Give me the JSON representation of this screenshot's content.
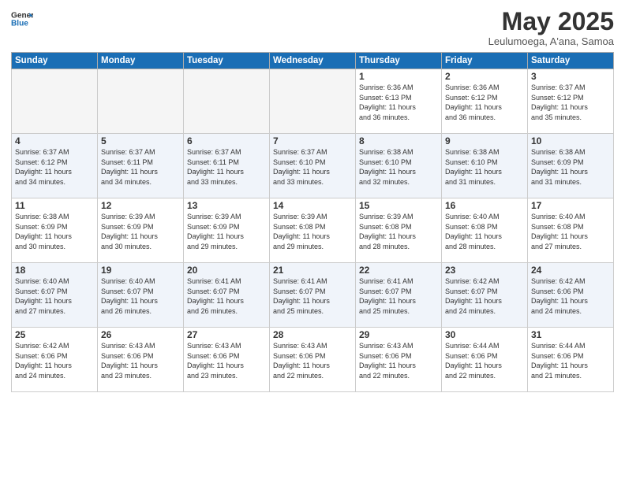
{
  "logo": {
    "line1": "General",
    "line2": "Blue"
  },
  "title": "May 2025",
  "subtitle": "Leulumoega, A'ana, Samoa",
  "days_of_week": [
    "Sunday",
    "Monday",
    "Tuesday",
    "Wednesday",
    "Thursday",
    "Friday",
    "Saturday"
  ],
  "weeks": [
    [
      {
        "day": "",
        "info": ""
      },
      {
        "day": "",
        "info": ""
      },
      {
        "day": "",
        "info": ""
      },
      {
        "day": "",
        "info": ""
      },
      {
        "day": "1",
        "info": "Sunrise: 6:36 AM\nSunset: 6:13 PM\nDaylight: 11 hours\nand 36 minutes."
      },
      {
        "day": "2",
        "info": "Sunrise: 6:36 AM\nSunset: 6:12 PM\nDaylight: 11 hours\nand 36 minutes."
      },
      {
        "day": "3",
        "info": "Sunrise: 6:37 AM\nSunset: 6:12 PM\nDaylight: 11 hours\nand 35 minutes."
      }
    ],
    [
      {
        "day": "4",
        "info": "Sunrise: 6:37 AM\nSunset: 6:12 PM\nDaylight: 11 hours\nand 34 minutes."
      },
      {
        "day": "5",
        "info": "Sunrise: 6:37 AM\nSunset: 6:11 PM\nDaylight: 11 hours\nand 34 minutes."
      },
      {
        "day": "6",
        "info": "Sunrise: 6:37 AM\nSunset: 6:11 PM\nDaylight: 11 hours\nand 33 minutes."
      },
      {
        "day": "7",
        "info": "Sunrise: 6:37 AM\nSunset: 6:10 PM\nDaylight: 11 hours\nand 33 minutes."
      },
      {
        "day": "8",
        "info": "Sunrise: 6:38 AM\nSunset: 6:10 PM\nDaylight: 11 hours\nand 32 minutes."
      },
      {
        "day": "9",
        "info": "Sunrise: 6:38 AM\nSunset: 6:10 PM\nDaylight: 11 hours\nand 31 minutes."
      },
      {
        "day": "10",
        "info": "Sunrise: 6:38 AM\nSunset: 6:09 PM\nDaylight: 11 hours\nand 31 minutes."
      }
    ],
    [
      {
        "day": "11",
        "info": "Sunrise: 6:38 AM\nSunset: 6:09 PM\nDaylight: 11 hours\nand 30 minutes."
      },
      {
        "day": "12",
        "info": "Sunrise: 6:39 AM\nSunset: 6:09 PM\nDaylight: 11 hours\nand 30 minutes."
      },
      {
        "day": "13",
        "info": "Sunrise: 6:39 AM\nSunset: 6:09 PM\nDaylight: 11 hours\nand 29 minutes."
      },
      {
        "day": "14",
        "info": "Sunrise: 6:39 AM\nSunset: 6:08 PM\nDaylight: 11 hours\nand 29 minutes."
      },
      {
        "day": "15",
        "info": "Sunrise: 6:39 AM\nSunset: 6:08 PM\nDaylight: 11 hours\nand 28 minutes."
      },
      {
        "day": "16",
        "info": "Sunrise: 6:40 AM\nSunset: 6:08 PM\nDaylight: 11 hours\nand 28 minutes."
      },
      {
        "day": "17",
        "info": "Sunrise: 6:40 AM\nSunset: 6:08 PM\nDaylight: 11 hours\nand 27 minutes."
      }
    ],
    [
      {
        "day": "18",
        "info": "Sunrise: 6:40 AM\nSunset: 6:07 PM\nDaylight: 11 hours\nand 27 minutes."
      },
      {
        "day": "19",
        "info": "Sunrise: 6:40 AM\nSunset: 6:07 PM\nDaylight: 11 hours\nand 26 minutes."
      },
      {
        "day": "20",
        "info": "Sunrise: 6:41 AM\nSunset: 6:07 PM\nDaylight: 11 hours\nand 26 minutes."
      },
      {
        "day": "21",
        "info": "Sunrise: 6:41 AM\nSunset: 6:07 PM\nDaylight: 11 hours\nand 25 minutes."
      },
      {
        "day": "22",
        "info": "Sunrise: 6:41 AM\nSunset: 6:07 PM\nDaylight: 11 hours\nand 25 minutes."
      },
      {
        "day": "23",
        "info": "Sunrise: 6:42 AM\nSunset: 6:07 PM\nDaylight: 11 hours\nand 24 minutes."
      },
      {
        "day": "24",
        "info": "Sunrise: 6:42 AM\nSunset: 6:06 PM\nDaylight: 11 hours\nand 24 minutes."
      }
    ],
    [
      {
        "day": "25",
        "info": "Sunrise: 6:42 AM\nSunset: 6:06 PM\nDaylight: 11 hours\nand 24 minutes."
      },
      {
        "day": "26",
        "info": "Sunrise: 6:43 AM\nSunset: 6:06 PM\nDaylight: 11 hours\nand 23 minutes."
      },
      {
        "day": "27",
        "info": "Sunrise: 6:43 AM\nSunset: 6:06 PM\nDaylight: 11 hours\nand 23 minutes."
      },
      {
        "day": "28",
        "info": "Sunrise: 6:43 AM\nSunset: 6:06 PM\nDaylight: 11 hours\nand 22 minutes."
      },
      {
        "day": "29",
        "info": "Sunrise: 6:43 AM\nSunset: 6:06 PM\nDaylight: 11 hours\nand 22 minutes."
      },
      {
        "day": "30",
        "info": "Sunrise: 6:44 AM\nSunset: 6:06 PM\nDaylight: 11 hours\nand 22 minutes."
      },
      {
        "day": "31",
        "info": "Sunrise: 6:44 AM\nSunset: 6:06 PM\nDaylight: 11 hours\nand 21 minutes."
      }
    ]
  ]
}
